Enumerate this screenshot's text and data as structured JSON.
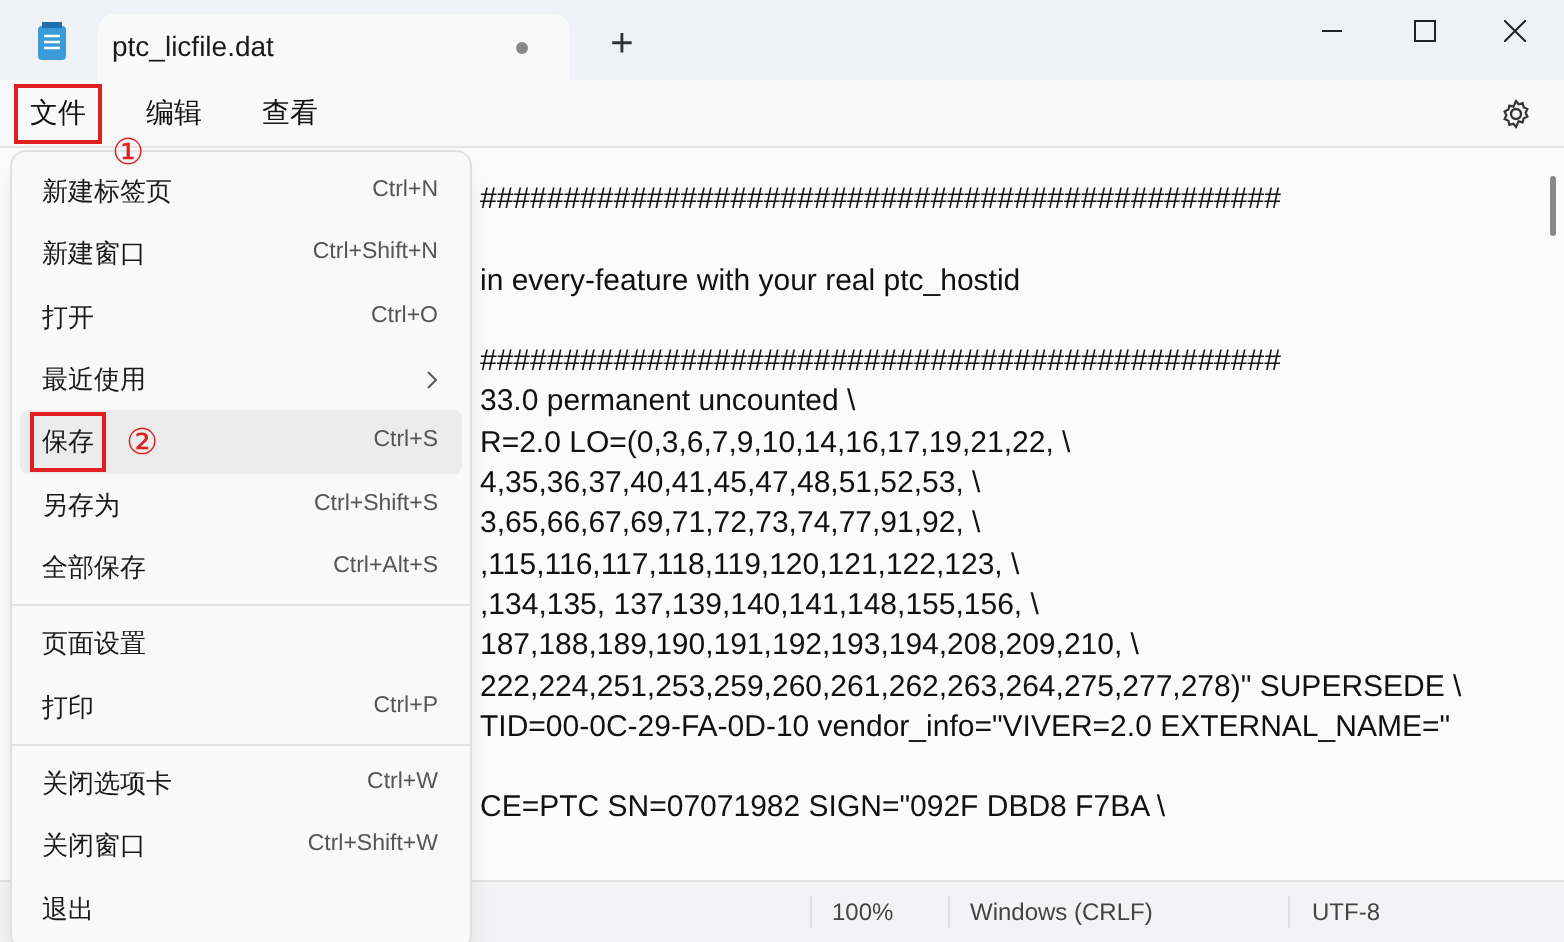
{
  "window": {
    "tab_title": "ptc_licfile.dat",
    "tab_modified": true,
    "new_tab": "+"
  },
  "menubar": [
    {
      "label": "文件",
      "selected": true,
      "callout": "①"
    },
    {
      "label": "编辑",
      "selected": false
    },
    {
      "label": "查看",
      "selected": false
    }
  ],
  "file_menu": {
    "groups": [
      [
        {
          "label": "新建标签页",
          "shortcut": "Ctrl+N",
          "kind": "command",
          "hovered": false
        },
        {
          "label": "新建窗口",
          "shortcut": "Ctrl+Shift+N",
          "kind": "command",
          "hovered": false
        },
        {
          "label": "打开",
          "shortcut": "Ctrl+O",
          "kind": "command",
          "hovered": false
        },
        {
          "label": "最近使用",
          "kind": "submenu",
          "hovered": false
        },
        {
          "label": "保存",
          "shortcut": "Ctrl+S",
          "kind": "command",
          "hovered": true,
          "callout": "②"
        },
        {
          "label": "另存为",
          "shortcut": "Ctrl+Shift+S",
          "kind": "command",
          "hovered": false
        },
        {
          "label": "全部保存",
          "shortcut": "Ctrl+Alt+S",
          "kind": "command",
          "hovered": false
        }
      ],
      [
        {
          "label": "页面设置",
          "kind": "command",
          "hovered": false
        },
        {
          "label": "打印",
          "shortcut": "Ctrl+P",
          "kind": "command",
          "hovered": false
        }
      ],
      [
        {
          "label": "关闭选项卡",
          "shortcut": "Ctrl+W",
          "kind": "command",
          "hovered": false
        },
        {
          "label": "关闭窗口",
          "shortcut": "Ctrl+Shift+W",
          "kind": "command",
          "hovered": false
        },
        {
          "label": "退出",
          "kind": "command",
          "hovered": false
        }
      ]
    ]
  },
  "editor": {
    "blocks": [
      [
        "################################################"
      ],
      [
        "in every-feature with your real ptc_hostid"
      ],
      [
        "################################################",
        "33.0 permanent uncounted \\",
        "R=2.0 LO=(0,3,6,7,9,10,14,16,17,19,21,22, \\",
        "4,35,36,37,40,41,45,47,48,51,52,53, \\",
        "3,65,66,67,69,71,72,73,74,77,91,92, \\",
        ",115,116,117,118,119,120,121,122,123, \\",
        ",134,135, 137,139,140,141,148,155,156, \\",
        "187,188,189,190,191,192,193,194,208,209,210, \\",
        "222,224,251,253,259,260,261,262,263,264,275,277,278)\" SUPERSEDE \\",
        "TID=00-0C-29-FA-0D-10 vendor_info=\"VIVER=2.0 EXTERNAL_NAME=\""
      ],
      [
        "CE=PTC SN=07071982 SIGN=\"092F DBD8 F7BA \\"
      ]
    ]
  },
  "status_bar": {
    "zoom": "100%",
    "line_ending": "Windows (CRLF)",
    "encoding": "UTF-8"
  }
}
